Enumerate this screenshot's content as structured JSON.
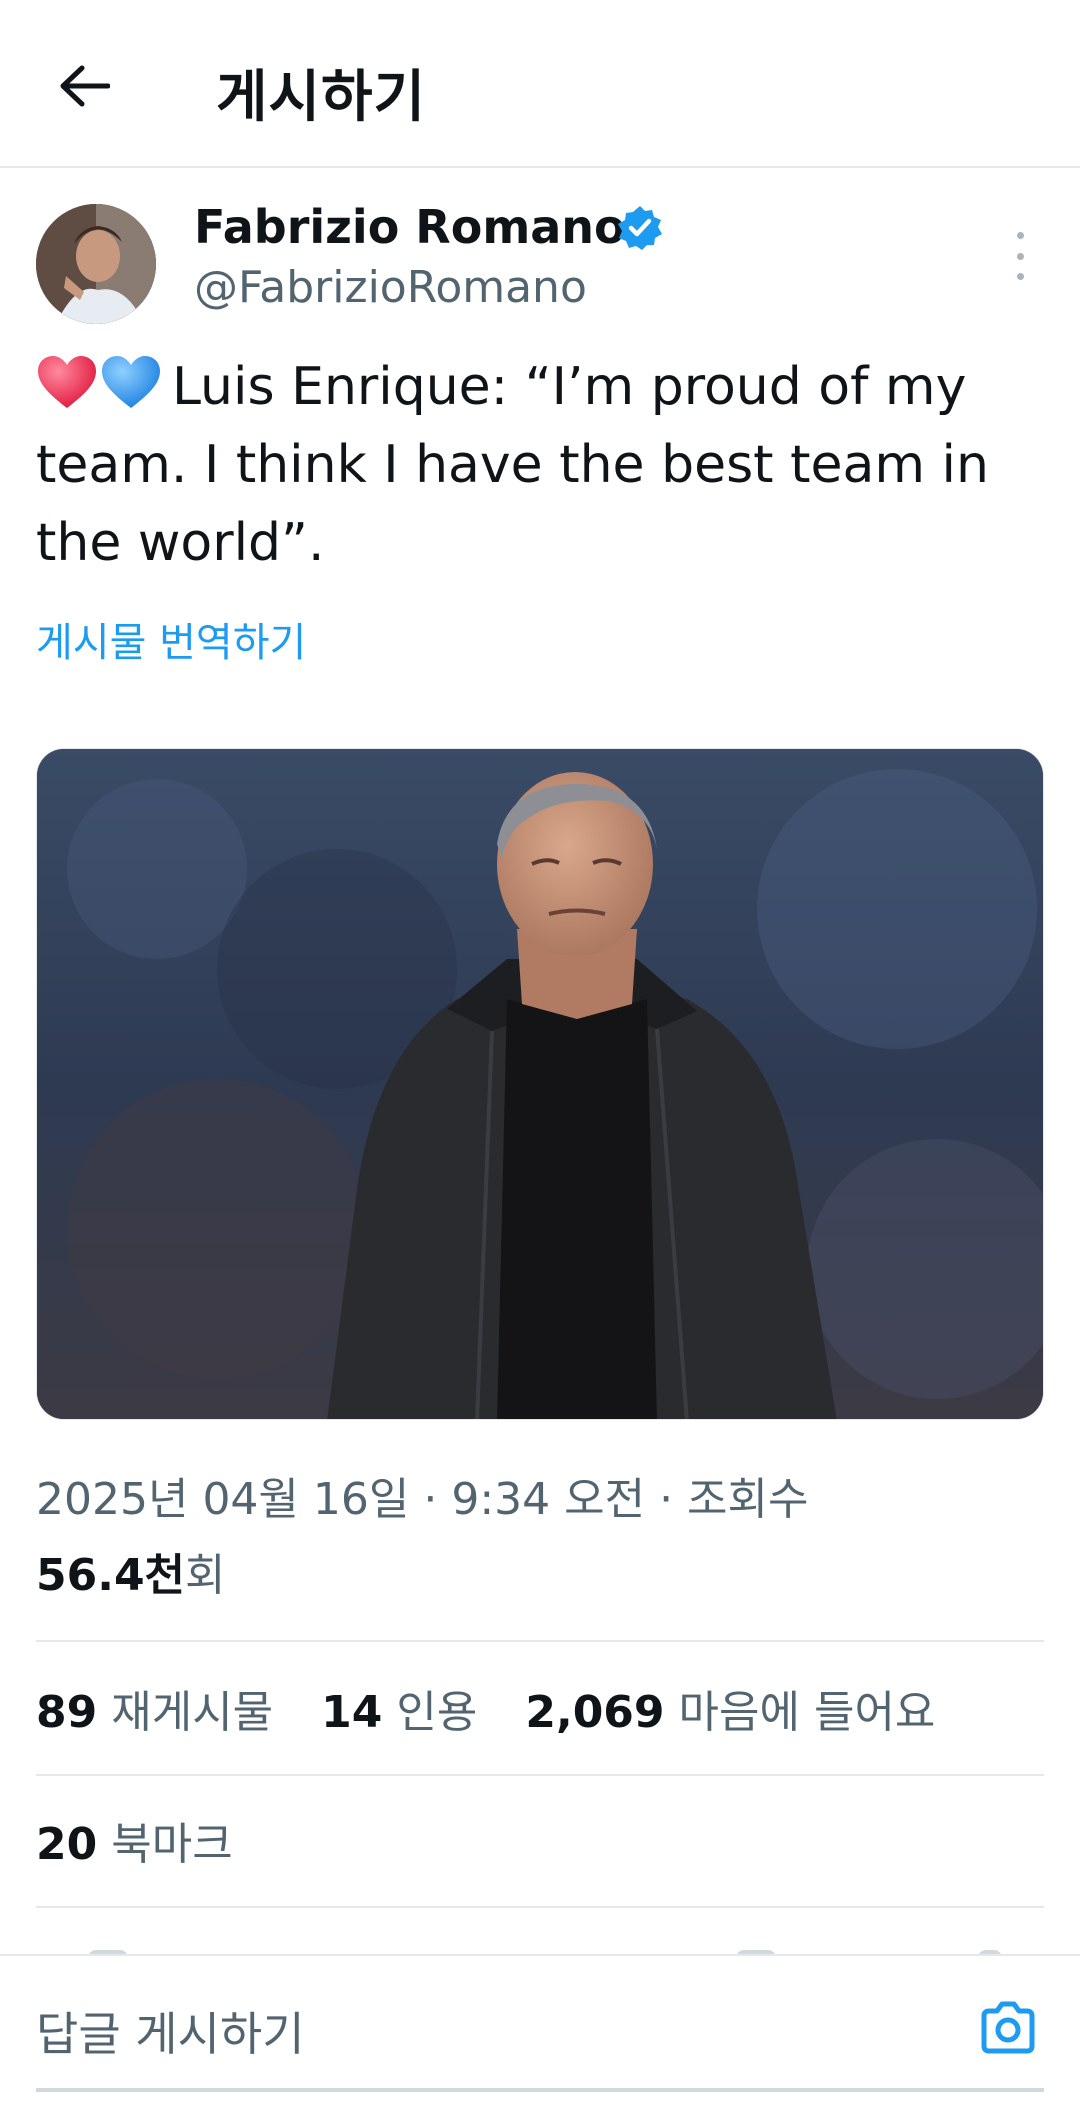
{
  "header": {
    "title": "게시하기"
  },
  "author": {
    "name": "Fabrizio Romano",
    "handle": "@FabrizioRomano"
  },
  "post": {
    "text": "Luis Enrique: “I’m proud of my team. I think I have the best team in the world”.",
    "translate_label": "게시물 번역하기"
  },
  "meta": {
    "datetime": "2025년 04월 16일 · 9:34 오전 · 조회수",
    "views_value": "56.4천",
    "views_unit": "회"
  },
  "stats": {
    "reposts_count": "89",
    "reposts_label": "재게시물",
    "quotes_count": "14",
    "quotes_label": "인용",
    "likes_count": "2,069",
    "likes_label": "마음에 들어요"
  },
  "bookmarks": {
    "count": "20",
    "label": "북마크"
  },
  "reply": {
    "placeholder": "답글 게시하기"
  },
  "colors": {
    "accent": "#1d9bf0",
    "text": "#0f1419",
    "secondary": "#536471",
    "border": "#e6e9ec"
  },
  "icons": {
    "back": "arrow-left-icon",
    "verified": "verified-badge-icon",
    "more": "more-vertical-icon",
    "camera": "camera-icon"
  }
}
